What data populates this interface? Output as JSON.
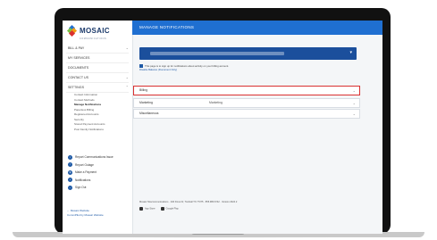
{
  "brand": {
    "name": "MOSAIC",
    "sub": "COMMUNICATIONS",
    "colors": {
      "navy": "#1b3a6b",
      "blue": "#1f6fd1",
      "red": "#d93030",
      "green": "#7ac143",
      "orange": "#f39c12"
    }
  },
  "header": {
    "title": "MANAGE NOTIFICATIONS"
  },
  "sidebar": {
    "items": [
      {
        "label": "BILL & PAY",
        "chevron": "⌄"
      },
      {
        "label": "MY SERVICES",
        "chevron": ""
      },
      {
        "label": "DOCUMENTS",
        "chevron": ""
      },
      {
        "label": "CONTACT US",
        "chevron": "⌄"
      },
      {
        "label": "SETTINGS",
        "chevron": "⌃"
      }
    ],
    "settings_sub": [
      "Contact Information",
      "Contact Methods",
      "Manage Notifications",
      "Paperless Billing",
      "Registered Accounts",
      "Security",
      "Stored Payment Accounts",
      "Post Family Notifications"
    ],
    "active_sub_index": 2,
    "actions": [
      {
        "label": "Report Communications Issue",
        "icon": "info-icon"
      },
      {
        "label": "Report Outage",
        "icon": "alert-icon"
      },
      {
        "label": "Make a Payment",
        "icon": "dollar-icon"
      },
      {
        "label": "Notifications",
        "icon": "bell-icon"
      },
      {
        "label": "Sign Out",
        "icon": "sign-out-icon"
      }
    ],
    "links": [
      "← Mosaic Website",
      "CommPilot by Mosaic Website"
    ]
  },
  "account_selector": {
    "caret": "▾"
  },
  "notice": {
    "text": "This page is to sign up for notifications about activity on your billing account.",
    "link": "Disable Balance (Document Only)"
  },
  "sections": [
    {
      "label": "Billing",
      "value": "",
      "chevron": "⌄",
      "highlighted": true
    },
    {
      "label": "Marketing",
      "value": "Marketing",
      "chevron": "⌄",
      "highlighted": false
    },
    {
      "label": "Miscellaneous",
      "value": "",
      "chevron": "⌄",
      "highlighted": false
    }
  ],
  "footer": {
    "line1": "Mosaic Telecommunications  ·  240 Ficus Dr, Tomball TX 77375  ·  855.986.6742  ·  Version 2024.2",
    "app_store": "App Store",
    "google_play": "Google Play"
  }
}
